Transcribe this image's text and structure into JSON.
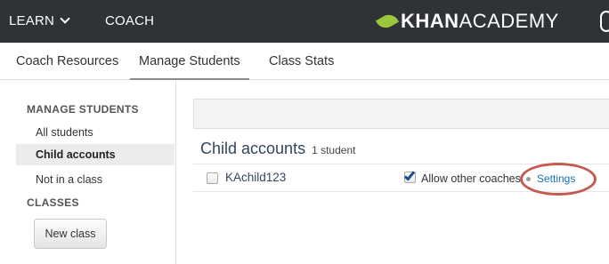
{
  "topnav": {
    "learn_label": "LEARN",
    "coach_label": "COACH",
    "logo_bold": "KHAN",
    "logo_rest": "ACADEMY"
  },
  "subnav": {
    "tabs": [
      {
        "label": "Coach Resources"
      },
      {
        "label": "Manage Students",
        "active": true
      },
      {
        "label": "Class Stats"
      }
    ]
  },
  "sidebar": {
    "manage_header": "MANAGE STUDENTS",
    "items": [
      {
        "label": "All students"
      },
      {
        "label": "Child accounts",
        "selected": true
      },
      {
        "label": "Not in a class"
      }
    ],
    "classes_header": "CLASSES",
    "new_class_label": "New class"
  },
  "main": {
    "heading": "Child accounts",
    "count_label": "1 student",
    "students": [
      {
        "name": "KAchild123",
        "checked": false,
        "allow_coaches_label": "Allow other coaches",
        "allow_coaches": true,
        "settings_label": "Settings"
      }
    ]
  },
  "colors": {
    "topbar": "#2f3236",
    "leaf": "#9cc63b",
    "heading": "#31465e",
    "link": "#1b6fbf",
    "annotation_circle": "#c45a50"
  }
}
